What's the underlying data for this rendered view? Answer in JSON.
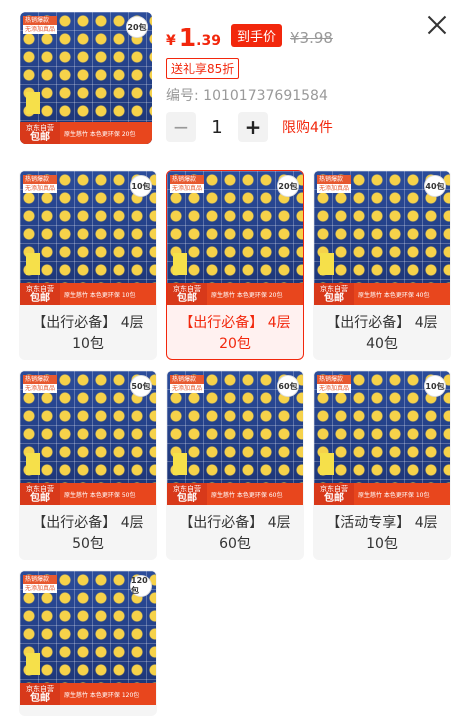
{
  "header": {
    "price_currency": "¥",
    "price_integer": "1",
    "price_decimal": ".39",
    "final_price_badge": "到手价",
    "original_price": "¥3.98",
    "promo_tag": "送礼享85折",
    "sku_label": "编号:",
    "sku_value": "10101737691584",
    "quantity": "1",
    "minus_symbol": "−",
    "plus_symbol": "+",
    "limit_text": "限购4件"
  },
  "thumbnail": {
    "count": "20包",
    "corner_line1": "热销爆款",
    "corner_line2": "无添加真品",
    "bottom_left_line1": "京东自营",
    "bottom_left_line2": "包邮",
    "bottom_text": "原生慈竹 本色更环保 20包"
  },
  "variants": [
    {
      "line1": "【出行必备】 4层",
      "line2": "10包",
      "count": "10包",
      "corner_line1": "热销爆款",
      "corner_line2": "无添加真品",
      "bottom_left_line1": "京东自营",
      "bottom_left_line2": "包邮",
      "bottom_text": "原生慈竹 本色更环保 10包",
      "selected": false
    },
    {
      "line1": "【出行必备】 4层",
      "line2": "20包",
      "count": "20包",
      "corner_line1": "热销爆款",
      "corner_line2": "无添加真品",
      "bottom_left_line1": "京东自营",
      "bottom_left_line2": "包邮",
      "bottom_text": "原生慈竹 本色更环保 20包",
      "selected": true
    },
    {
      "line1": "【出行必备】 4层",
      "line2": "40包",
      "count": "40包",
      "corner_line1": "热销爆款",
      "corner_line2": "无添加真品",
      "bottom_left_line1": "京东自营",
      "bottom_left_line2": "包邮",
      "bottom_text": "原生慈竹 本色更环保 40包",
      "selected": false
    },
    {
      "line1": "【出行必备】 4层",
      "line2": "50包",
      "count": "50包",
      "corner_line1": "热销爆款",
      "corner_line2": "无添加真品",
      "bottom_left_line1": "京东自营",
      "bottom_left_line2": "包邮",
      "bottom_text": "原生慈竹 本色更环保 50包",
      "selected": false
    },
    {
      "line1": "【出行必备】 4层",
      "line2": "60包",
      "count": "60包",
      "corner_line1": "热销爆款",
      "corner_line2": "无添加真品",
      "bottom_left_line1": "京东自营",
      "bottom_left_line2": "包邮",
      "bottom_text": "原生慈竹 本色更环保 60包",
      "selected": false
    },
    {
      "line1": "【活动专享】 4层",
      "line2": "10包",
      "count": "10包",
      "corner_line1": "热销爆款",
      "corner_line2": "无添加真品",
      "bottom_left_line1": "京东自营",
      "bottom_left_line2": "包邮",
      "bottom_text": "原生慈竹 本色更环保 10包",
      "selected": false
    },
    {
      "line1": "",
      "line2": "",
      "count": "120包",
      "corner_line1": "热销爆款",
      "corner_line2": "无添加真品",
      "bottom_left_line1": "京东自营",
      "bottom_left_line2": "包邮",
      "bottom_text": "原生慈竹 本色更环保 120包",
      "selected": false
    }
  ],
  "colors": {
    "accent": "#f2270c",
    "card_bg": "#f5f5f5",
    "selected_bg": "#fff1f0"
  },
  "icons": {
    "close": "close-icon"
  }
}
